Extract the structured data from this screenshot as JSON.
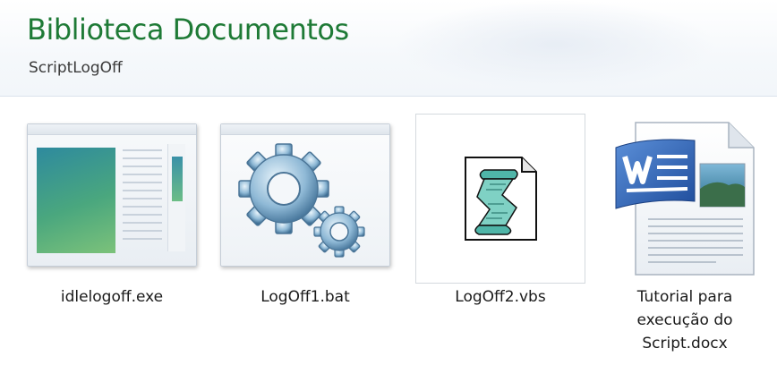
{
  "library": {
    "title": "Biblioteca Documentos",
    "subtitle": "ScriptLogOff"
  },
  "files": [
    {
      "name": "idlelogoff.exe",
      "icon": "exe-window-thumbnail-icon"
    },
    {
      "name": "LogOff1.bat",
      "icon": "gears-batch-icon"
    },
    {
      "name": "LogOff2.vbs",
      "icon": "vbscript-scroll-icon"
    },
    {
      "name_lines": [
        "Tutorial para",
        "execução do",
        "Script.docx"
      ],
      "icon": "word-document-icon"
    }
  ],
  "colors": {
    "title_green": "#1e7a36",
    "word_blue": "#2b5aa8"
  }
}
